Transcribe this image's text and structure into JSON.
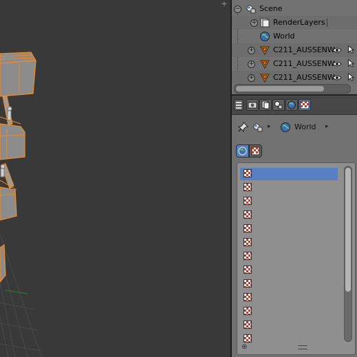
{
  "outliner": {
    "rows": [
      {
        "label": "Scene",
        "icon": "scene-icon"
      },
      {
        "label": "RenderLayers",
        "icon": "render-layers-icon"
      },
      {
        "label": "World",
        "icon": "world-icon"
      },
      {
        "label": "C211_AUSSENW",
        "icon": "mesh-object-icon"
      },
      {
        "label": "C211_AUSSENW",
        "icon": "mesh-object-icon"
      },
      {
        "label": "C211_AUSSENW",
        "icon": "mesh-object-icon"
      }
    ]
  },
  "properties": {
    "breadcrumb": {
      "pin_icon": "pin-icon",
      "scene_icon": "scene-icon",
      "world_label": "World"
    },
    "tabs": [
      "render-tab",
      "render-layers-tab",
      "scene-tab",
      "world-tab",
      "texture-tab"
    ],
    "active_tab": "texture-tab",
    "context_buttons": [
      "world-context",
      "texture-context"
    ],
    "texture_slots": {
      "count": 13,
      "selected_index": 0
    }
  },
  "colors": {
    "accent": "#5680c2",
    "selection_orange": "#f08a24",
    "viewport_bg": "#393939",
    "panel_bg": "#727272"
  }
}
